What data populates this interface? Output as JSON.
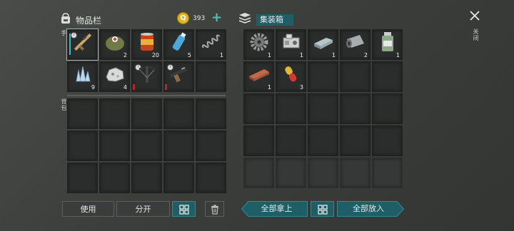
{
  "inventory": {
    "title": "物品栏",
    "coins": "393",
    "add_symbol": "+",
    "hand_label": "手",
    "backpack_label": "背包",
    "hand_slots": [
      {
        "icon": "rifle-icon",
        "qty": ""
      },
      {
        "icon": "medkit-bag-icon",
        "qty": "2"
      },
      {
        "icon": "canned-food-icon",
        "qty": "20"
      },
      {
        "icon": "water-bottle-icon",
        "qty": "5"
      },
      {
        "icon": "spring-coil-icon",
        "qty": "1"
      },
      {
        "icon": "crystal-icon",
        "qty": "9"
      },
      {
        "icon": "ore-rock-icon",
        "qty": "4"
      },
      {
        "icon": "crossbow-icon",
        "qty": ""
      },
      {
        "icon": "pistol-icon",
        "qty": ""
      },
      {
        "icon": "",
        "qty": ""
      }
    ]
  },
  "container": {
    "title": "集装箱",
    "close_label": "关闭",
    "slots": [
      {
        "icon": "gear-icon",
        "qty": "1"
      },
      {
        "icon": "engine-part-icon",
        "qty": "1"
      },
      {
        "icon": "metal-ingot-icon",
        "qty": "1"
      },
      {
        "icon": "metal-sheet-roll-icon",
        "qty": "2"
      },
      {
        "icon": "medicine-jar-icon",
        "qty": "1"
      },
      {
        "icon": "wood-plank-icon",
        "qty": "1"
      },
      {
        "icon": "pill-capsule-icon",
        "qty": "3"
      }
    ]
  },
  "buttons": {
    "use": "使用",
    "split": "分开",
    "take_all": "全部拿上",
    "put_all": "全部放入"
  },
  "colors": {
    "accent": "#2e8a94",
    "accent_dark": "#1f5e66",
    "slot_bg": "#2b2d2c",
    "coin": "#e2b21c"
  }
}
